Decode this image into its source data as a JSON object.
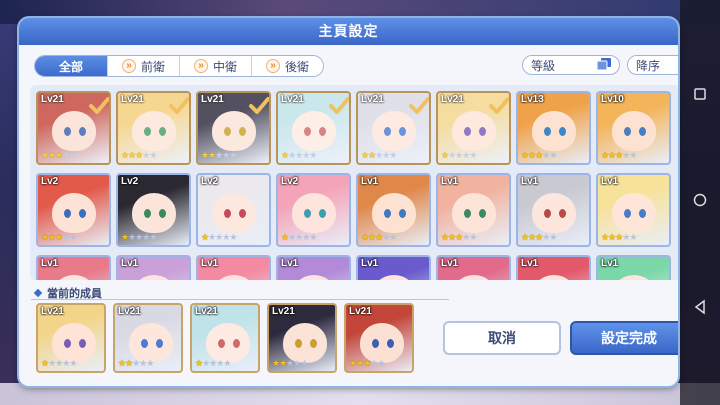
{
  "dialog": {
    "title": "主頁設定"
  },
  "tabs": [
    {
      "label": "全部",
      "active": true
    },
    {
      "label": "前衛",
      "active": false
    },
    {
      "label": "中衛",
      "active": false
    },
    {
      "label": "後衛",
      "active": false
    }
  ],
  "sort": {
    "level_label": "等級",
    "order_label": "降序"
  },
  "characters": [
    {
      "level": "Lv21",
      "stars": 3,
      "selected": true,
      "hair": "#c4463a",
      "skin": "#fbe0d4",
      "eye": "#3d5fb0"
    },
    {
      "level": "Lv21",
      "stars": 3,
      "selected": true,
      "hair": "#f5cf7a",
      "skin": "#fde6d8",
      "eye": "#4a9e6a"
    },
    {
      "level": "Lv21",
      "stars": 2,
      "selected": true,
      "hair": "#2e2a3e",
      "skin": "#fbe3d8",
      "eye": "#c9a02c"
    },
    {
      "level": "Lv21",
      "stars": 1,
      "selected": true,
      "hair": "#bfe3e8",
      "skin": "#fdebe3",
      "eye": "#d06a6a"
    },
    {
      "level": "Lv21",
      "stars": 2,
      "selected": true,
      "hair": "#d9d9e4",
      "skin": "#fde6dc",
      "eye": "#4c7bd1"
    },
    {
      "level": "Lv21",
      "stars": 1,
      "selected": true,
      "hair": "#f3d58a",
      "skin": "#fde4d6",
      "eye": "#7a5cb8"
    },
    {
      "level": "Lv13",
      "stars": 3,
      "selected": false,
      "hair": "#f0a24a",
      "skin": "#fde2d2",
      "eye": "#3d86c8"
    },
    {
      "level": "Lv10",
      "stars": 3,
      "selected": false,
      "hair": "#f3b45a",
      "skin": "#fde2d2",
      "eye": "#4a7ec2"
    },
    {
      "level": "Lv2",
      "stars": 3,
      "selected": false,
      "hair": "#e25a4a",
      "skin": "#fde2d6",
      "eye": "#3a6fc0"
    },
    {
      "level": "Lv2",
      "stars": 1,
      "selected": false,
      "hair": "#2a2830",
      "skin": "#fbe4da",
      "eye": "#3a8a5a"
    },
    {
      "level": "Lv2",
      "stars": 1,
      "selected": false,
      "hair": "#ebe8ee",
      "skin": "#fde8e0",
      "eye": "#c84a5a"
    },
    {
      "level": "Lv2",
      "stars": 1,
      "selected": false,
      "hair": "#f4a4b8",
      "skin": "#fde4dc",
      "eye": "#3aa0b0"
    },
    {
      "level": "Lv1",
      "stars": 3,
      "selected": false,
      "hair": "#e0874a",
      "skin": "#fde2d2",
      "eye": "#3d7ac0"
    },
    {
      "level": "Lv1",
      "stars": 3,
      "selected": false,
      "hair": "#f1b2a0",
      "skin": "#fde4d8",
      "eye": "#3a8a6a"
    },
    {
      "level": "Lv1",
      "stars": 3,
      "selected": false,
      "hair": "#c9c9d2",
      "skin": "#fde6de",
      "eye": "#b84a4a"
    },
    {
      "level": "Lv1",
      "stars": 3,
      "selected": false,
      "hair": "#f7e29a",
      "skin": "#fde6d8",
      "eye": "#4a7ac8"
    },
    {
      "level": "Lv1",
      "stars": 0,
      "selected": false,
      "hair": "#e87a8a",
      "skin": "#fde4dc",
      "eye": "#3d5fb0"
    },
    {
      "level": "Lv1",
      "stars": 0,
      "selected": false,
      "hair": "#c9a0d8",
      "skin": "#fde4dc",
      "eye": "#3d5fb0"
    },
    {
      "level": "Lv1",
      "stars": 0,
      "selected": false,
      "hair": "#f48aa2",
      "skin": "#fde4dc",
      "eye": "#3d5fb0"
    },
    {
      "level": "Lv1",
      "stars": 0,
      "selected": false,
      "hair": "#b28ad8",
      "skin": "#fde4dc",
      "eye": "#3d5fb0"
    },
    {
      "level": "Lv1",
      "stars": 0,
      "selected": false,
      "hair": "#6a5acd",
      "skin": "#fde4dc",
      "eye": "#3d5fb0"
    },
    {
      "level": "Lv1",
      "stars": 0,
      "selected": false,
      "hair": "#e26a8a",
      "skin": "#fde4dc",
      "eye": "#3d5fb0"
    },
    {
      "level": "Lv1",
      "stars": 0,
      "selected": false,
      "hair": "#e25a6a",
      "skin": "#fde4dc",
      "eye": "#3d5fb0"
    },
    {
      "level": "Lv1",
      "stars": 0,
      "selected": false,
      "hair": "#7ad8a8",
      "skin": "#fde4dc",
      "eye": "#3d5fb0"
    }
  ],
  "members_title": "當前的成員",
  "members": [
    {
      "level": "Lv21",
      "stars": 1,
      "hair": "#f3d58a",
      "skin": "#fde4d6",
      "eye": "#7a5cb8"
    },
    {
      "level": "Lv21",
      "stars": 2,
      "hair": "#d9d9e4",
      "skin": "#fde6dc",
      "eye": "#4c7bd1"
    },
    {
      "level": "Lv21",
      "stars": 1,
      "hair": "#bfe3e8",
      "skin": "#fdebe3",
      "eye": "#d06a6a"
    },
    {
      "level": "Lv21",
      "stars": 2,
      "hair": "#2e2a3e",
      "skin": "#fbe3d8",
      "eye": "#c9a02c"
    },
    {
      "level": "Lv21",
      "stars": 3,
      "hair": "#c4463a",
      "skin": "#fbe0d4",
      "eye": "#3d5fb0"
    }
  ],
  "buttons": {
    "cancel": "取消",
    "confirm": "設定完成"
  },
  "colors": {
    "accent": "#3d6ccc",
    "check": "#f0b23a",
    "star": "#f3c125"
  },
  "icons": {
    "sort": "list-sort-icon",
    "level": "square-stack-icon",
    "tab": "double-chevron-icon"
  }
}
